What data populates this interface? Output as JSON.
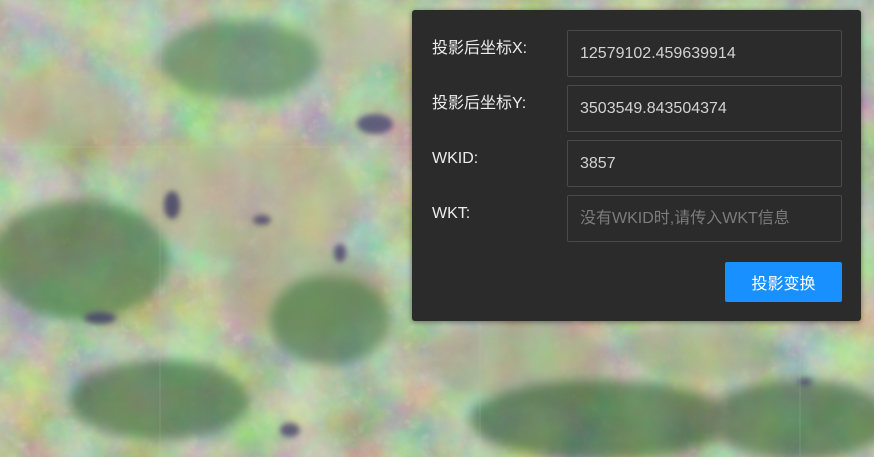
{
  "projection_panel": {
    "fields": [
      {
        "label": "投影后坐标X:",
        "value": "12579102.459639914",
        "placeholder": ""
      },
      {
        "label": "投影后坐标Y:",
        "value": "3503549.843504374",
        "placeholder": ""
      },
      {
        "label": "WKID:",
        "value": "3857",
        "placeholder": ""
      },
      {
        "label": "WKT:",
        "value": "",
        "placeholder": "没有WKID时,请传入WKT信息"
      }
    ],
    "button_label": "投影变换"
  },
  "colors": {
    "panel_background": "#2b2b2b",
    "field_border": "#4a4a4a",
    "label_text": "#ececec",
    "value_text": "#d2d2d2",
    "placeholder_text": "#7c7c7c",
    "button_background": "#1890ff",
    "button_text": "#ffffff"
  }
}
